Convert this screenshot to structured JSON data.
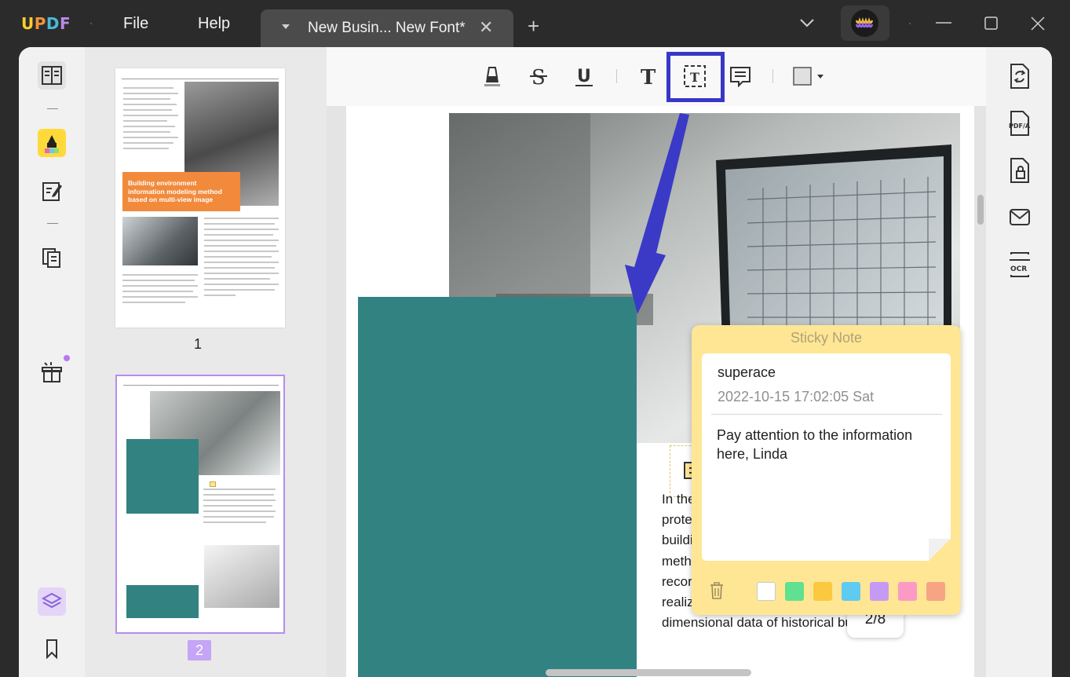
{
  "app": {
    "logo": "UPDF"
  },
  "menu": {
    "file": "File",
    "help": "Help"
  },
  "tab": {
    "title": "New Busin... New Font*",
    "close": "✕"
  },
  "new_tab": "+",
  "window_controls": {
    "minimize": "minimize-icon",
    "maximize": "maximize-icon",
    "close": "close-icon"
  },
  "left_tools": [
    "reader-icon",
    "comment-icon",
    "edit-icon",
    "organize-icon",
    "gift-icon",
    "layers-icon",
    "bookmark-icon"
  ],
  "toolbar": [
    "highlight-icon",
    "strikethrough-icon",
    "underline-icon",
    "text-icon",
    "textbox-icon",
    "comment-note-icon",
    "shape-icon"
  ],
  "thumbnails": {
    "page1": {
      "label": "1",
      "orange_title": "Building environment information modeling method based on multi-view image"
    },
    "page2": {
      "label": "2"
    }
  },
  "sticky_note": {
    "title": "Sticky Note",
    "author": "superace",
    "date": "2022-10-15 17:02:05 Sat",
    "message": "Pay attention to the information here, Linda",
    "colors": [
      "#ffffff",
      "#5fe18f",
      "#fbc93f",
      "#5fcbf1",
      "#c59af4",
      "#fb9ac4",
      "#f7a485"
    ]
  },
  "document": {
    "paragraph": "In the process of data collection and protection of protected buildings, the use of multi-perspective building environment information modeling method can quickly and efficiently save and record its three-dimensional information, and realize the preservation and inheritance of multi-dimensional data of historical buildings."
  },
  "pager": "2/8",
  "right_tools": [
    "convert-icon",
    "pdfa-icon",
    "protect-icon",
    "share-email-icon",
    "ocr-icon"
  ],
  "accent": "#3737c8"
}
